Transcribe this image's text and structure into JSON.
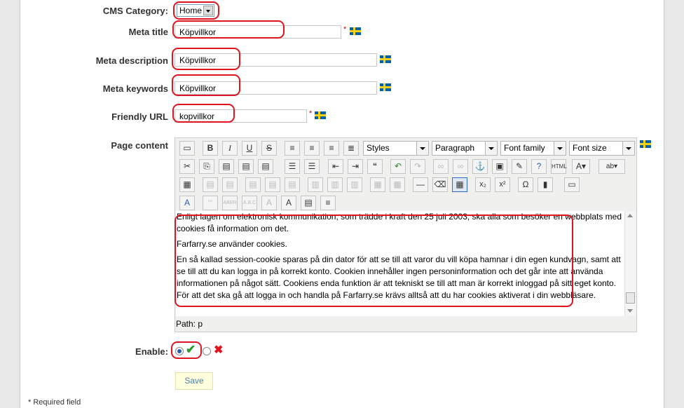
{
  "form": {
    "cms_category": {
      "label": "CMS Category:",
      "value": "Home"
    },
    "meta_title": {
      "label": "Meta title",
      "value": "Köpvillkor",
      "required_mark": "*"
    },
    "meta_description": {
      "label": "Meta description",
      "value": "Köpvillkor"
    },
    "meta_keywords": {
      "label": "Meta keywords",
      "value": "Köpvillkor"
    },
    "friendly_url": {
      "label": "Friendly URL",
      "value": "kopvillkor",
      "required_mark": "*"
    },
    "page_content": {
      "label": "Page content"
    },
    "enable": {
      "label": "Enable:",
      "selected": "yes"
    },
    "save_label": "Save",
    "required_note": "* Required field"
  },
  "editor": {
    "styles_label": "Styles",
    "format_label": "Paragraph",
    "font_family_label": "Font family",
    "font_size_label": "Font size",
    "paragraphs": [
      "Enligt lagen om elektronisk kommunikation, som trädde i kraft den 25 juli 2003, ska alla som besöker en webbplats med cookies få information om det.",
      "Farfarry.se använder cookies.",
      "En så kallad session-cookie sparas på din dator för att se till att varor du vill köpa hamnar i din egen kundvagn, samt att se till att du kan logga in på korrekt konto. Cookien innehåller ingen personinformation och det går inte att använda informationen på något sätt. Cookiens enda funktion är att tekniskt se till att man är korrekt inloggad på sitt eget konto. För att det ska gå att logga in och handla på Farfarry.se krävs alltså att du har cookies aktiverat i din webbläsare."
    ],
    "path_label": "Path: p"
  },
  "colors": {
    "annotation": "#e0141e",
    "flag_blue": "#0061a8",
    "flag_yellow": "#f7d117"
  }
}
